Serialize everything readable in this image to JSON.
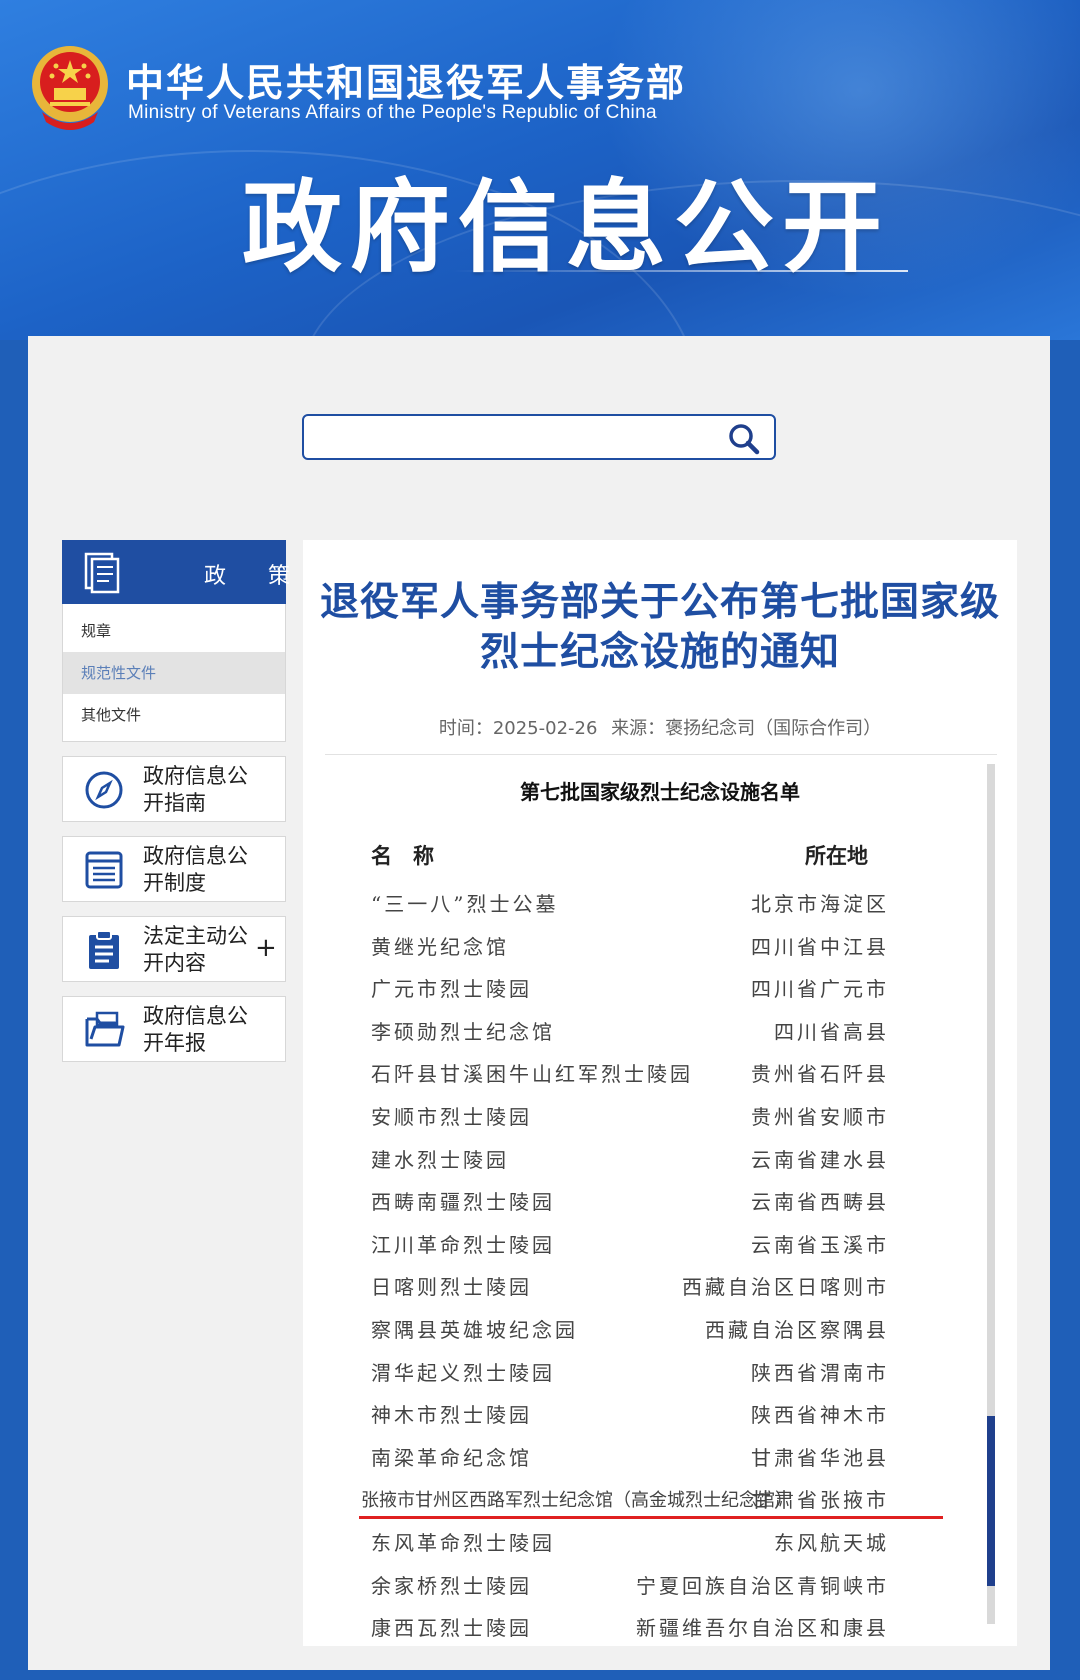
{
  "header": {
    "ministry_cn": "中华人民共和国退役军人事务部",
    "ministry_en": "Ministry of Veterans Affairs of the People's Republic of China",
    "banner_title": "政府信息公开",
    "emblem": "national-emblem-icon"
  },
  "search": {
    "placeholder": "",
    "icon": "search-icon"
  },
  "sidebar": {
    "policy_head": {
      "char1": "政",
      "char2": "策",
      "toggle": "−",
      "icon": "document-icon"
    },
    "policy_items": [
      "规章",
      "规范性文件",
      "其他文件"
    ],
    "cards": [
      {
        "label": "政府信息公开指南",
        "icon": "compass-icon"
      },
      {
        "label": "政府信息公开制度",
        "icon": "list-icon"
      },
      {
        "label": "法定主动公开内容",
        "icon": "clipboard-icon",
        "toggle": "+"
      },
      {
        "label": "政府信息公开年报",
        "icon": "folder-icon"
      }
    ]
  },
  "article": {
    "title": "退役军人事务部关于公布第七批国家级烈士纪念设施的通知",
    "time_label": "时间：2025-02-26",
    "source_label": "来源：褒扬纪念司（国际合作司）",
    "list_title": "第七批国家级烈士纪念设施名单",
    "col_name": "名　称",
    "col_location": "所在地",
    "rows": [
      {
        "name": "“三一八”烈士公墓",
        "location": "北京市海淀区"
      },
      {
        "name": "黄继光纪念馆",
        "location": "四川省中江县"
      },
      {
        "name": "广元市烈士陵园",
        "location": "四川省广元市"
      },
      {
        "name": "李硕勋烈士纪念馆",
        "location": "四川省高县"
      },
      {
        "name": "石阡县甘溪困牛山红军烈士陵园",
        "location": "贵州省石阡县"
      },
      {
        "name": "安顺市烈士陵园",
        "location": "贵州省安顺市"
      },
      {
        "name": "建水烈士陵园",
        "location": "云南省建水县"
      },
      {
        "name": "西畴南疆烈士陵园",
        "location": "云南省西畴县"
      },
      {
        "name": "江川革命烈士陵园",
        "location": "云南省玉溪市"
      },
      {
        "name": "日喀则烈士陵园",
        "location": "西藏自治区日喀则市"
      },
      {
        "name": "察隅县英雄坡纪念园",
        "location": "西藏自治区察隅县"
      },
      {
        "name": "渭华起义烈士陵园",
        "location": "陕西省渭南市"
      },
      {
        "name": "神木市烈士陵园",
        "location": "陕西省神木市"
      },
      {
        "name": "南梁革命纪念馆",
        "location": "甘肃省华池县"
      },
      {
        "name": "张掖市甘州区西路军烈士纪念馆（高金城烈士纪念馆）",
        "location": "甘肃省张掖市",
        "highlight": true
      },
      {
        "name": "东风革命烈士陵园",
        "location": "东风航天城"
      },
      {
        "name": "余家桥烈士陵园",
        "location": "宁夏回族自治区青铜峡市"
      },
      {
        "name": "康西瓦烈士陵园",
        "location": "新疆维吾尔自治区和康县"
      }
    ]
  },
  "colors": {
    "brand_blue": "#1f4ea2",
    "highlight_red": "#e02020"
  }
}
